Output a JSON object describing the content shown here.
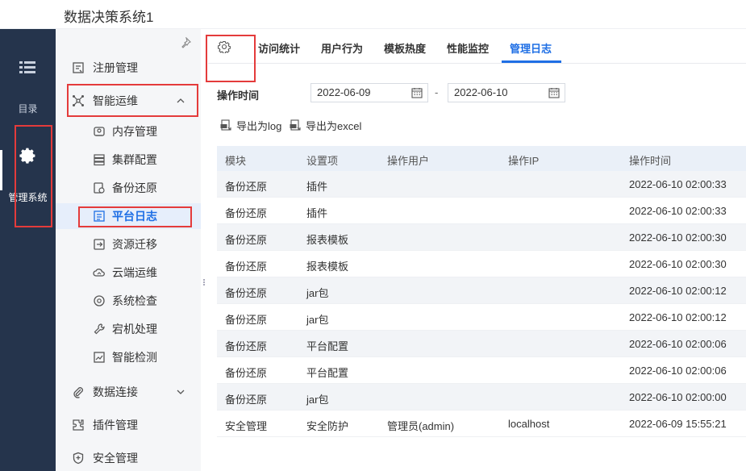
{
  "app": {
    "title": "数据决策系统1"
  },
  "rail": {
    "catalog_label": "目录",
    "manage_label": "管理系统"
  },
  "sidenav": {
    "items": [
      {
        "label": "注册管理",
        "icon": "register-icon"
      },
      {
        "label": "智能运维",
        "icon": "network-icon",
        "expanded": true
      },
      {
        "label": "内存管理",
        "icon": "memory-icon"
      },
      {
        "label": "集群配置",
        "icon": "cluster-icon"
      },
      {
        "label": "备份还原",
        "icon": "backup-icon"
      },
      {
        "label": "平台日志",
        "icon": "log-icon",
        "active": true
      },
      {
        "label": "资源迁移",
        "icon": "migrate-icon"
      },
      {
        "label": "云端运维",
        "icon": "cloud-icon"
      },
      {
        "label": "系统检查",
        "icon": "check-icon"
      },
      {
        "label": "宕机处理",
        "icon": "wrench-icon"
      },
      {
        "label": "智能检测",
        "icon": "monitor-icon"
      },
      {
        "label": "数据连接",
        "icon": "link-icon"
      },
      {
        "label": "插件管理",
        "icon": "plugin-icon"
      },
      {
        "label": "安全管理",
        "icon": "shield-icon"
      }
    ]
  },
  "tabs": [
    {
      "label": "访问统计"
    },
    {
      "label": "用户行为"
    },
    {
      "label": "模板热度"
    },
    {
      "label": "性能监控"
    },
    {
      "label": "管理日志",
      "active": true
    }
  ],
  "filter": {
    "label": "操作时间",
    "start_date": "2022-06-09",
    "end_date": "2022-06-10",
    "separator": "-"
  },
  "export": {
    "log_label": "导出为log",
    "excel_label": "导出为excel"
  },
  "table": {
    "columns": [
      "模块",
      "设置项",
      "操作用户",
      "操作IP",
      "操作时间"
    ],
    "rows": [
      [
        "备份还原",
        "插件",
        "",
        "",
        "2022-06-10 02:00:33"
      ],
      [
        "备份还原",
        "插件",
        "",
        "",
        "2022-06-10 02:00:33"
      ],
      [
        "备份还原",
        "报表模板",
        "",
        "",
        "2022-06-10 02:00:30"
      ],
      [
        "备份还原",
        "报表模板",
        "",
        "",
        "2022-06-10 02:00:30"
      ],
      [
        "备份还原",
        "jar包",
        "",
        "",
        "2022-06-10 02:00:12"
      ],
      [
        "备份还原",
        "jar包",
        "",
        "",
        "2022-06-10 02:00:12"
      ],
      [
        "备份还原",
        "平台配置",
        "",
        "",
        "2022-06-10 02:00:06"
      ],
      [
        "备份还原",
        "平台配置",
        "",
        "",
        "2022-06-10 02:00:06"
      ],
      [
        "备份还原",
        "jar包",
        "",
        "",
        "2022-06-10 02:00:00"
      ],
      [
        "安全管理",
        "安全防护",
        "管理员(admin)",
        "localhost",
        "2022-06-09 15:55:21"
      ]
    ]
  },
  "colors": {
    "accent": "#1f6fe5",
    "rail_bg": "#25344c",
    "highlight": "#e43b3b"
  }
}
